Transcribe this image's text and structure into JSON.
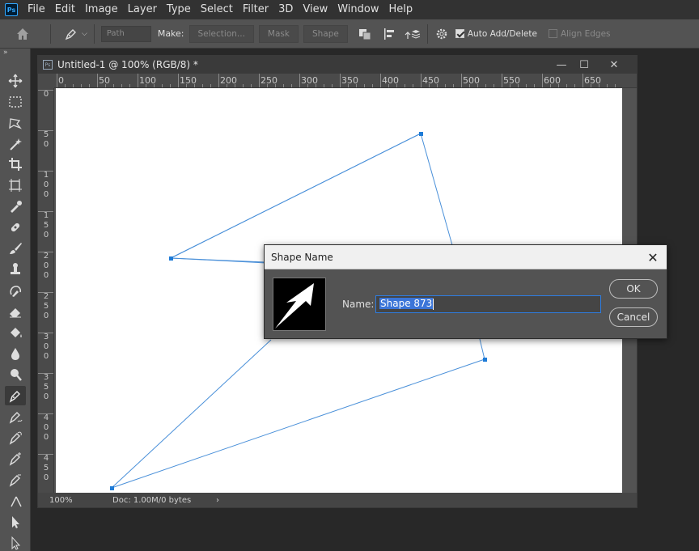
{
  "app": {
    "logo": "Ps",
    "menu": [
      "File",
      "Edit",
      "Image",
      "Layer",
      "Type",
      "Select",
      "Filter",
      "3D",
      "View",
      "Window",
      "Help"
    ]
  },
  "options_bar": {
    "tool_icon": "pen-icon",
    "mode_dropdown": "Path",
    "make_label": "Make:",
    "selection_btn": "Selection...",
    "mask_btn": "Mask",
    "shape_btn": "Shape",
    "auto_add_delete": {
      "label": "Auto Add/Delete",
      "checked": true
    },
    "align_edges": {
      "label": "Align Edges",
      "checked": false
    }
  },
  "toolbar": {
    "collapse": "»",
    "tools": [
      "move-icon",
      "marquee-icon",
      "lasso-icon",
      "magic-wand-icon",
      "crop-icon",
      "frame-icon",
      "eyedropper-icon",
      "healing-brush-icon",
      "brush-icon",
      "clone-stamp-icon",
      "history-brush-icon",
      "eraser-icon",
      "paint-bucket-icon",
      "blur-icon",
      "dodge-icon",
      "pen-icon",
      "freeform-pen-icon",
      "curvature-pen-icon",
      "add-anchor-icon",
      "delete-anchor-icon",
      "convert-point-icon",
      "path-selection-icon",
      "direct-selection-icon",
      "type-icon"
    ],
    "active_tool": "pen-icon"
  },
  "document": {
    "title": "Untitled-1 @ 100% (RGB/8) *",
    "ps_badge": "Ps",
    "ruler_h": [
      "0",
      "50",
      "100",
      "150",
      "200",
      "250",
      "300",
      "350",
      "400",
      "450",
      "500",
      "550",
      "600",
      "650"
    ],
    "ruler_v": [
      "0",
      "50",
      "100",
      "150",
      "200",
      "250",
      "300",
      "350",
      "400",
      "450"
    ],
    "zoom": "100%",
    "doc_info": "Doc: 1.00M/0 bytes",
    "status_arrow": "›",
    "path_color": "#4a90d9",
    "anchor_color": "#1e7bd7"
  },
  "dialog": {
    "title": "Shape Name",
    "name_label": "Name:",
    "name_value": "Shape 873",
    "ok_label": "OK",
    "cancel_label": "Cancel",
    "close_icon": "close-icon"
  }
}
